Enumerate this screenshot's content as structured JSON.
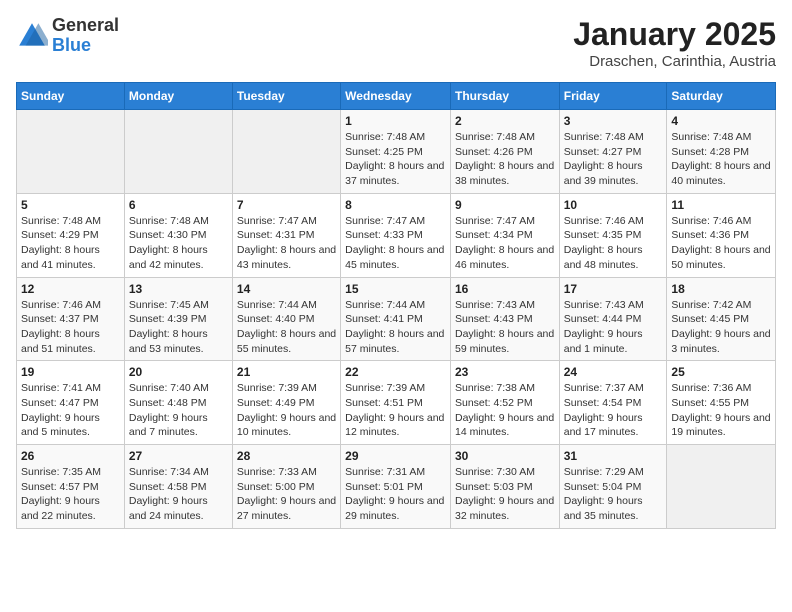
{
  "header": {
    "logo_general": "General",
    "logo_blue": "Blue",
    "title": "January 2025",
    "subtitle": "Draschen, Carinthia, Austria"
  },
  "calendar": {
    "days_of_week": [
      "Sunday",
      "Monday",
      "Tuesday",
      "Wednesday",
      "Thursday",
      "Friday",
      "Saturday"
    ],
    "weeks": [
      [
        {
          "day": "",
          "info": ""
        },
        {
          "day": "",
          "info": ""
        },
        {
          "day": "",
          "info": ""
        },
        {
          "day": "1",
          "info": "Sunrise: 7:48 AM\nSunset: 4:25 PM\nDaylight: 8 hours and 37 minutes."
        },
        {
          "day": "2",
          "info": "Sunrise: 7:48 AM\nSunset: 4:26 PM\nDaylight: 8 hours and 38 minutes."
        },
        {
          "day": "3",
          "info": "Sunrise: 7:48 AM\nSunset: 4:27 PM\nDaylight: 8 hours and 39 minutes."
        },
        {
          "day": "4",
          "info": "Sunrise: 7:48 AM\nSunset: 4:28 PM\nDaylight: 8 hours and 40 minutes."
        }
      ],
      [
        {
          "day": "5",
          "info": "Sunrise: 7:48 AM\nSunset: 4:29 PM\nDaylight: 8 hours and 41 minutes."
        },
        {
          "day": "6",
          "info": "Sunrise: 7:48 AM\nSunset: 4:30 PM\nDaylight: 8 hours and 42 minutes."
        },
        {
          "day": "7",
          "info": "Sunrise: 7:47 AM\nSunset: 4:31 PM\nDaylight: 8 hours and 43 minutes."
        },
        {
          "day": "8",
          "info": "Sunrise: 7:47 AM\nSunset: 4:33 PM\nDaylight: 8 hours and 45 minutes."
        },
        {
          "day": "9",
          "info": "Sunrise: 7:47 AM\nSunset: 4:34 PM\nDaylight: 8 hours and 46 minutes."
        },
        {
          "day": "10",
          "info": "Sunrise: 7:46 AM\nSunset: 4:35 PM\nDaylight: 8 hours and 48 minutes."
        },
        {
          "day": "11",
          "info": "Sunrise: 7:46 AM\nSunset: 4:36 PM\nDaylight: 8 hours and 50 minutes."
        }
      ],
      [
        {
          "day": "12",
          "info": "Sunrise: 7:46 AM\nSunset: 4:37 PM\nDaylight: 8 hours and 51 minutes."
        },
        {
          "day": "13",
          "info": "Sunrise: 7:45 AM\nSunset: 4:39 PM\nDaylight: 8 hours and 53 minutes."
        },
        {
          "day": "14",
          "info": "Sunrise: 7:44 AM\nSunset: 4:40 PM\nDaylight: 8 hours and 55 minutes."
        },
        {
          "day": "15",
          "info": "Sunrise: 7:44 AM\nSunset: 4:41 PM\nDaylight: 8 hours and 57 minutes."
        },
        {
          "day": "16",
          "info": "Sunrise: 7:43 AM\nSunset: 4:43 PM\nDaylight: 8 hours and 59 minutes."
        },
        {
          "day": "17",
          "info": "Sunrise: 7:43 AM\nSunset: 4:44 PM\nDaylight: 9 hours and 1 minute."
        },
        {
          "day": "18",
          "info": "Sunrise: 7:42 AM\nSunset: 4:45 PM\nDaylight: 9 hours and 3 minutes."
        }
      ],
      [
        {
          "day": "19",
          "info": "Sunrise: 7:41 AM\nSunset: 4:47 PM\nDaylight: 9 hours and 5 minutes."
        },
        {
          "day": "20",
          "info": "Sunrise: 7:40 AM\nSunset: 4:48 PM\nDaylight: 9 hours and 7 minutes."
        },
        {
          "day": "21",
          "info": "Sunrise: 7:39 AM\nSunset: 4:49 PM\nDaylight: 9 hours and 10 minutes."
        },
        {
          "day": "22",
          "info": "Sunrise: 7:39 AM\nSunset: 4:51 PM\nDaylight: 9 hours and 12 minutes."
        },
        {
          "day": "23",
          "info": "Sunrise: 7:38 AM\nSunset: 4:52 PM\nDaylight: 9 hours and 14 minutes."
        },
        {
          "day": "24",
          "info": "Sunrise: 7:37 AM\nSunset: 4:54 PM\nDaylight: 9 hours and 17 minutes."
        },
        {
          "day": "25",
          "info": "Sunrise: 7:36 AM\nSunset: 4:55 PM\nDaylight: 9 hours and 19 minutes."
        }
      ],
      [
        {
          "day": "26",
          "info": "Sunrise: 7:35 AM\nSunset: 4:57 PM\nDaylight: 9 hours and 22 minutes."
        },
        {
          "day": "27",
          "info": "Sunrise: 7:34 AM\nSunset: 4:58 PM\nDaylight: 9 hours and 24 minutes."
        },
        {
          "day": "28",
          "info": "Sunrise: 7:33 AM\nSunset: 5:00 PM\nDaylight: 9 hours and 27 minutes."
        },
        {
          "day": "29",
          "info": "Sunrise: 7:31 AM\nSunset: 5:01 PM\nDaylight: 9 hours and 29 minutes."
        },
        {
          "day": "30",
          "info": "Sunrise: 7:30 AM\nSunset: 5:03 PM\nDaylight: 9 hours and 32 minutes."
        },
        {
          "day": "31",
          "info": "Sunrise: 7:29 AM\nSunset: 5:04 PM\nDaylight: 9 hours and 35 minutes."
        },
        {
          "day": "",
          "info": ""
        }
      ]
    ]
  }
}
